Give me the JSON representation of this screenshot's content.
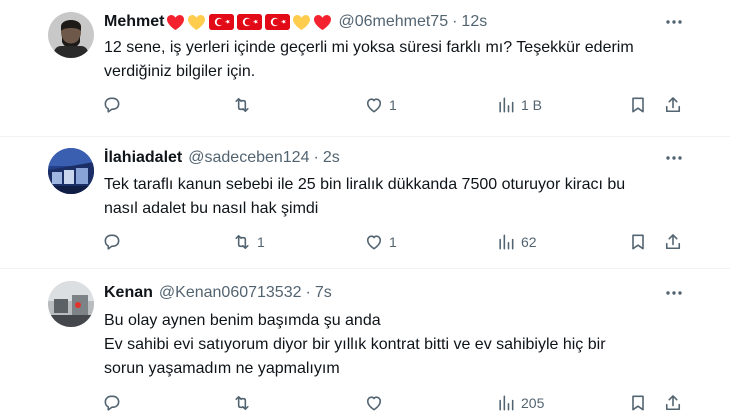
{
  "tweets": [
    {
      "name": "Mehmet",
      "handle": "@06mehmet75",
      "sep": "·",
      "time": "12s",
      "text_lines": [
        "12 sene, iş yerleri içinde geçerli mi yoksa süresi farklı mı? Teşekkür ederim",
        "verdiğiniz bilgiler için."
      ],
      "replies": "",
      "retweets": "",
      "likes": "1",
      "views": "1 B",
      "name_emojis": [
        "red-heart",
        "yellow-heart",
        "turkey-flag",
        "turkey-flag",
        "turkey-flag",
        "yellow-heart",
        "red-heart"
      ]
    },
    {
      "name": "İlahiadalet",
      "handle": "@sadeceben124",
      "sep": "·",
      "time": "2s",
      "text_lines": [
        "Tek taraflı kanun sebebi ile 25 bin liralık dükkanda 7500 oturuyor kiracı bu",
        "nasıl adalet bu nasıl hak şimdi"
      ],
      "replies": "",
      "retweets": "1",
      "likes": "1",
      "views": "62"
    },
    {
      "name": "Kenan",
      "handle": "@Kenan060713532",
      "sep": "·",
      "time": "7s",
      "text_lines": [
        "Bu olay aynen benim başımda şu anda",
        "Ev sahibi evi satıyorum diyor bir yıllık kontrat bitti ve ev sahibiyle hiç bir",
        "sorun yaşamadım ne yapmalıyım"
      ],
      "replies": "",
      "retweets": "",
      "likes": "",
      "views": "205"
    }
  ],
  "icons": {
    "reply": "reply-icon",
    "retweet": "retweet-icon",
    "like": "heart-icon",
    "views": "views-icon",
    "bookmark": "bookmark-icon",
    "share": "share-icon",
    "more": "more-icon"
  },
  "colors": {
    "text": "#0f1419",
    "secondary": "#536471",
    "divider": "#eff3f4",
    "flag_red": "#e30a17",
    "heart_red": "#f4212e",
    "heart_yellow": "#ffcc4d"
  }
}
